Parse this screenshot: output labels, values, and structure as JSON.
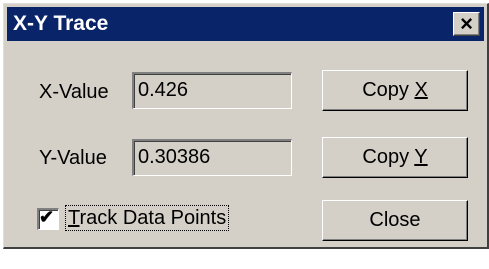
{
  "window": {
    "title": "X-Y Trace",
    "close_glyph": "×"
  },
  "x_row": {
    "label": "X-Value",
    "value": "0.426",
    "copy_prefix": "Copy ",
    "copy_mnemonic": "X"
  },
  "y_row": {
    "label": "Y-Value",
    "value": "0.30386",
    "copy_prefix": "Copy ",
    "copy_mnemonic": "Y"
  },
  "track": {
    "checked": true,
    "check_glyph": "✔",
    "mnemonic": "T",
    "rest": "rack Data Points"
  },
  "close_button": {
    "label": "Close"
  },
  "colors": {
    "titlebar": "#0a246a",
    "face": "#d4d0c8"
  }
}
